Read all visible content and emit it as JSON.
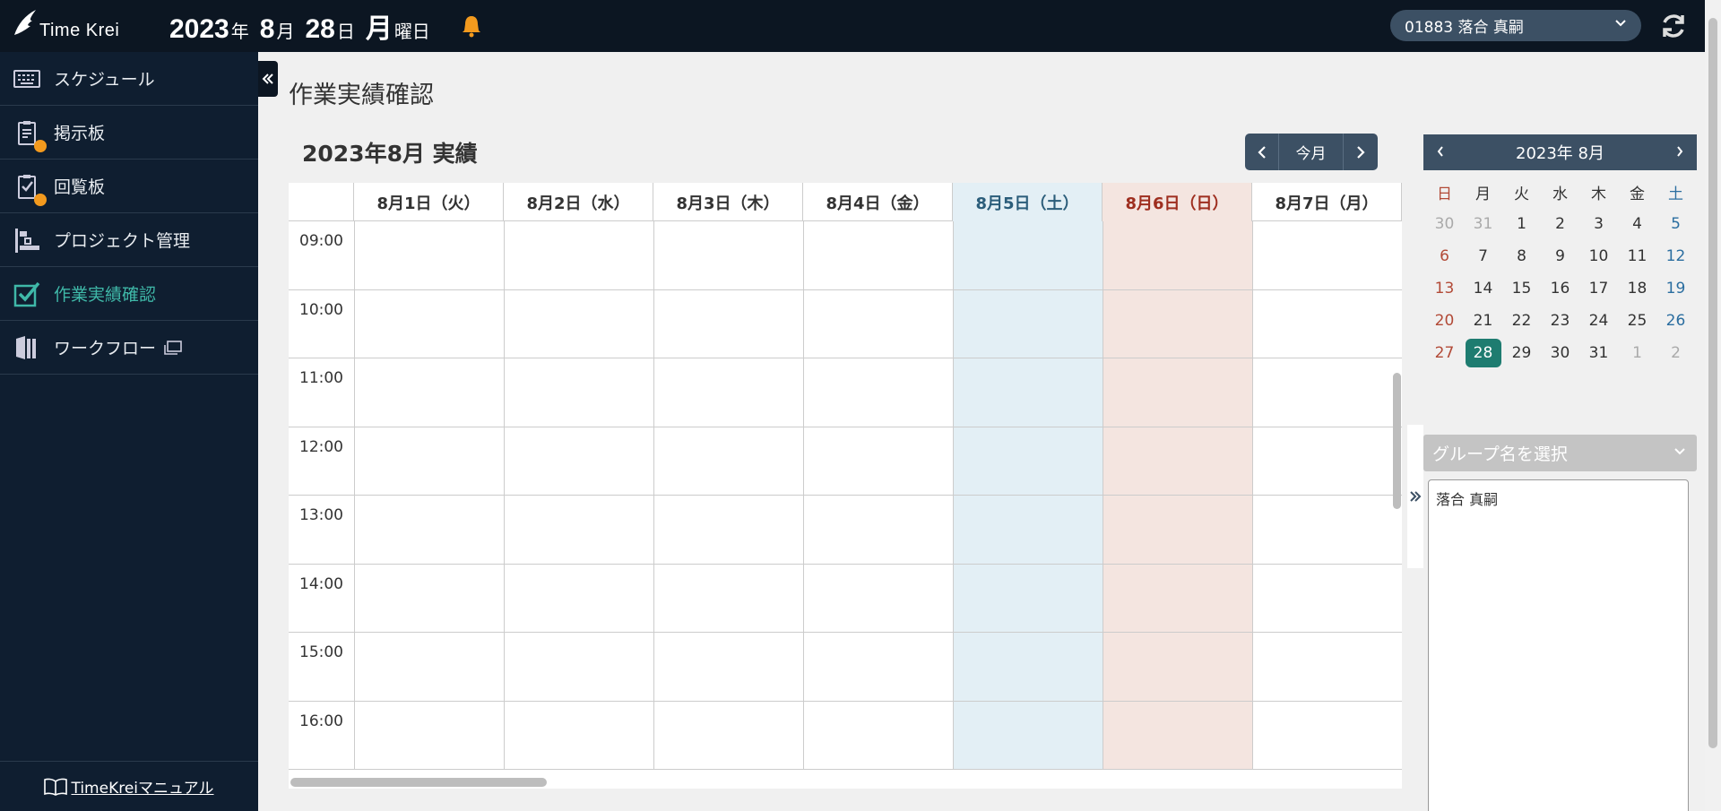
{
  "header": {
    "app_name": "Time Krei",
    "date": {
      "year": "2023",
      "year_unit": "年",
      "month": "8",
      "month_unit": "月",
      "day": "28",
      "day_unit": "日",
      "weekday": "月",
      "weekday_unit": "曜日"
    },
    "user": "01883 落合 真嗣",
    "colors": {
      "bg": "#0c1622",
      "bell": "#f39a1e"
    }
  },
  "sidebar": {
    "items": [
      {
        "label": "スケジュール",
        "icon": "keyboard-icon",
        "badge": false
      },
      {
        "label": "掲示板",
        "icon": "clipboard-icon",
        "badge": true
      },
      {
        "label": "回覧板",
        "icon": "clipboard-check-icon",
        "badge": true
      },
      {
        "label": "プロジェクト管理",
        "icon": "gantt-icon",
        "badge": false
      },
      {
        "label": "作業実績確認",
        "icon": "checkbox-icon",
        "active": true
      },
      {
        "label": "ワークフロー",
        "icon": "book-icon",
        "badge": false
      }
    ],
    "manual": "TimeKreiマニュアル",
    "active_color": "#3fb8a8"
  },
  "main": {
    "page_title": "作業実績確認",
    "month_title": "2023年8月 実績",
    "nav": {
      "prev": "‹",
      "today": "今月",
      "next": "›"
    },
    "days": [
      {
        "label": "8月1日（火）",
        "type": "weekday"
      },
      {
        "label": "8月2日（水）",
        "type": "weekday"
      },
      {
        "label": "8月3日（木）",
        "type": "weekday"
      },
      {
        "label": "8月4日（金）",
        "type": "weekday"
      },
      {
        "label": "8月5日（土）",
        "type": "sat"
      },
      {
        "label": "8月6日（日）",
        "type": "sun"
      },
      {
        "label": "8月7日（月）",
        "type": "weekday"
      }
    ],
    "times": [
      "09:00",
      "10:00",
      "11:00",
      "12:00",
      "13:00",
      "14:00",
      "15:00",
      "16:00"
    ]
  },
  "mini_calendar": {
    "title": "2023年 8月",
    "prev": "‹",
    "next": "›",
    "weekdays": [
      "日",
      "月",
      "火",
      "水",
      "木",
      "金",
      "土"
    ],
    "weeks": [
      [
        {
          "d": "30",
          "dim": true
        },
        {
          "d": "31",
          "dim": true
        },
        {
          "d": "1"
        },
        {
          "d": "2"
        },
        {
          "d": "3"
        },
        {
          "d": "4"
        },
        {
          "d": "5"
        }
      ],
      [
        {
          "d": "6"
        },
        {
          "d": "7"
        },
        {
          "d": "8"
        },
        {
          "d": "9"
        },
        {
          "d": "10"
        },
        {
          "d": "11"
        },
        {
          "d": "12"
        }
      ],
      [
        {
          "d": "13"
        },
        {
          "d": "14"
        },
        {
          "d": "15"
        },
        {
          "d": "16"
        },
        {
          "d": "17"
        },
        {
          "d": "18"
        },
        {
          "d": "19"
        }
      ],
      [
        {
          "d": "20"
        },
        {
          "d": "21"
        },
        {
          "d": "22"
        },
        {
          "d": "23"
        },
        {
          "d": "24"
        },
        {
          "d": "25"
        },
        {
          "d": "26"
        }
      ],
      [
        {
          "d": "27"
        },
        {
          "d": "28",
          "today": true
        },
        {
          "d": "29"
        },
        {
          "d": "30"
        },
        {
          "d": "31"
        },
        {
          "d": "1",
          "dim": true
        },
        {
          "d": "2",
          "dim": true
        }
      ]
    ],
    "today_color": "#1e7c70"
  },
  "group": {
    "placeholder": "グループ名を選択",
    "members": [
      "落合 真嗣"
    ]
  }
}
